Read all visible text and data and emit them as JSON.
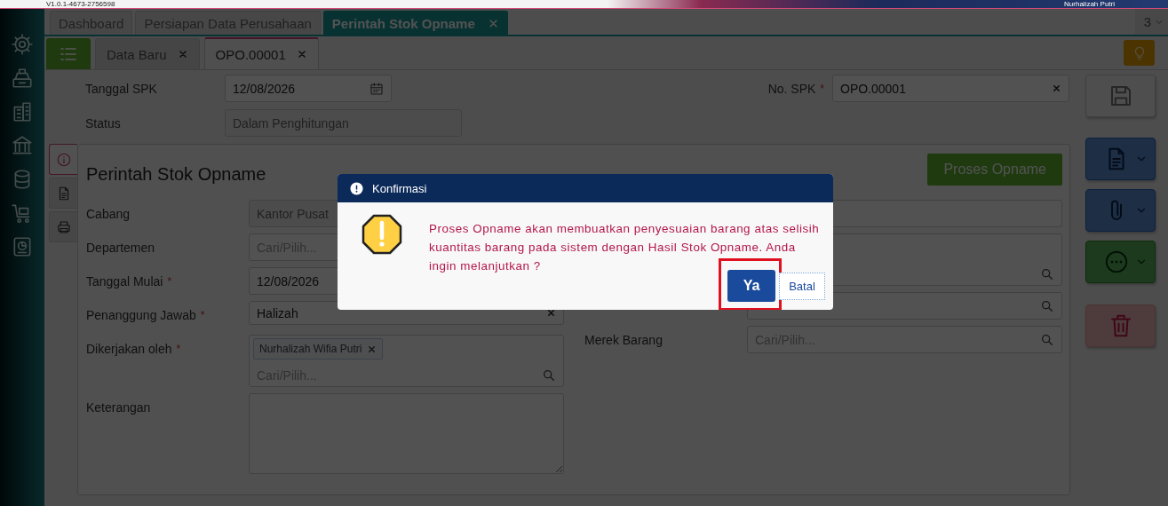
{
  "top_bar": {
    "version": "V1.0.1-4673-2756598",
    "user": "Nurhalizah Putri"
  },
  "sidebar": {
    "items": [
      {
        "kind": "settings"
      },
      {
        "kind": "register"
      },
      {
        "kind": "building"
      },
      {
        "kind": "bank"
      },
      {
        "kind": "database"
      },
      {
        "kind": "cart"
      },
      {
        "kind": "report"
      }
    ]
  },
  "tabs": [
    {
      "label": "Dashboard",
      "selected": false,
      "closable": false
    },
    {
      "label": "Persiapan Data Perusahaan",
      "selected": false,
      "closable": false
    },
    {
      "label": "Perintah Stok Opname",
      "selected": true,
      "closable": true
    }
  ],
  "tab_count": "3",
  "subtabs": [
    {
      "label": "Data Baru",
      "selected": false
    },
    {
      "label": "OPO.00001",
      "selected": true
    }
  ],
  "header_fields": [
    {
      "label": "Tanggal SPK",
      "kind": "date",
      "value": "12/08/2026"
    },
    {
      "label": "No. SPK",
      "required_mark": "*",
      "kind": "clear",
      "value": "OPO.00001"
    },
    {
      "label": "Status",
      "kind": "text",
      "value": "Dalam Penghitungan",
      "disabled": true
    }
  ],
  "panel": {
    "title": "Perintah Stok Opname",
    "action_button": "Proses Opname",
    "side_tabs": [
      {
        "kind": "info",
        "selected": true
      },
      {
        "kind": "document",
        "selected": false
      },
      {
        "kind": "print",
        "selected": false
      }
    ],
    "left_fields": [
      {
        "label": "Cabang",
        "kind": "text",
        "value": "Kantor Pusat",
        "disabled": true
      },
      {
        "label": "Departemen",
        "kind": "search",
        "placeholder": "Cari/Pilih..."
      },
      {
        "label": "Tanggal Mulai",
        "required_mark": "*",
        "kind": "date",
        "value": "12/08/2026"
      },
      {
        "label": "Penanggung Jawab",
        "required_mark": "*",
        "kind": "clear",
        "value": "Halizah"
      },
      {
        "label": "Dikerjakan oleh",
        "required_mark": "*",
        "kind": "multi",
        "chips": [
          "Nurhalizah Wifia Putri"
        ],
        "placeholder": "Cari/Pilih..."
      },
      {
        "label": "Keterangan",
        "kind": "textarea"
      }
    ],
    "right_fields": [
      {
        "kind": "text"
      },
      {
        "kind": "multi"
      },
      {
        "kind": "search"
      },
      {
        "label": "Merek Barang",
        "kind": "search",
        "placeholder": "Cari/Pilih..."
      }
    ]
  },
  "action_rail": [
    {
      "kind": "save",
      "dropdown": false
    },
    {
      "kind": "document",
      "dropdown": true
    },
    {
      "kind": "attach",
      "dropdown": true
    },
    {
      "kind": "more",
      "dropdown": true
    },
    {
      "kind": "delete",
      "dropdown": false
    }
  ],
  "dialog": {
    "title": "Konfirmasi",
    "message": "Proses Opname akan membuatkan penyesuaian barang atas selisih kuantitas barang pada sistem dengan Hasil Stok Opname. Anda ingin melanjutkan ?",
    "buttons": [
      {
        "label": "Ya",
        "kind": "primary",
        "highlighted": true
      },
      {
        "label": "Batal",
        "kind": "secondary",
        "highlighted": false
      }
    ]
  }
}
